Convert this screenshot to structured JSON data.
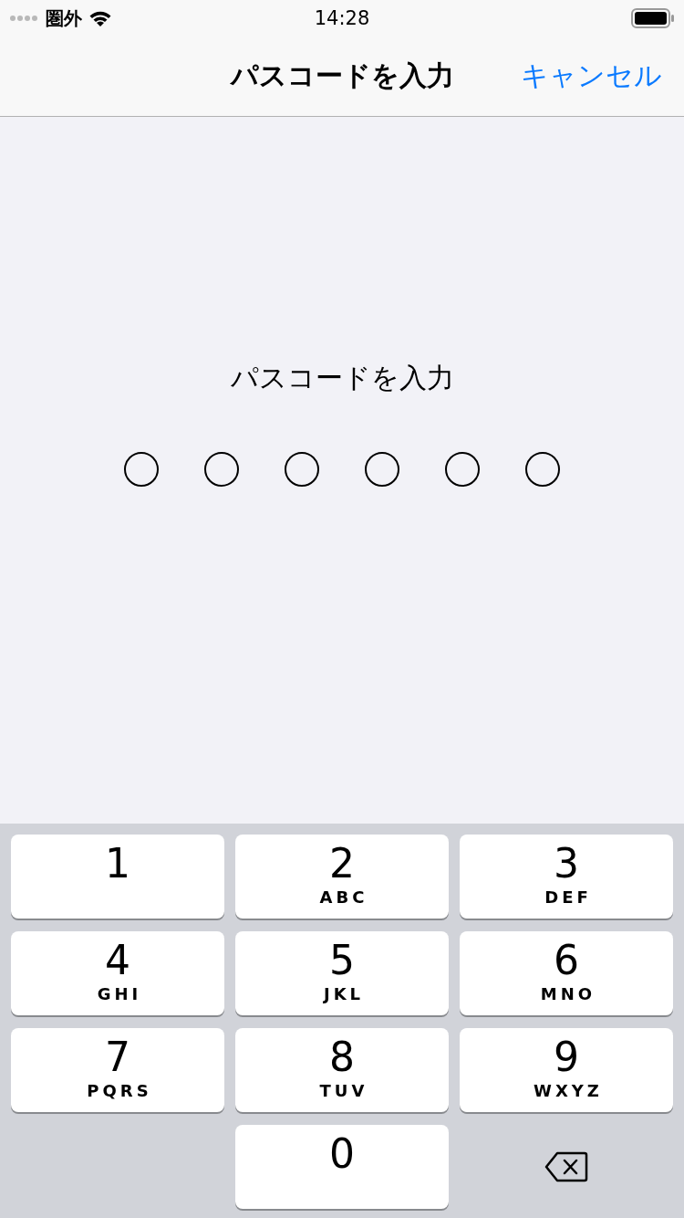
{
  "status_bar": {
    "carrier": "圏外",
    "time": "14:28"
  },
  "nav_bar": {
    "title": "パスコードを入力",
    "cancel": "キャンセル"
  },
  "prompt": "パスコードを入力",
  "passcode_dots": [
    {
      "filled": false
    },
    {
      "filled": false
    },
    {
      "filled": false
    },
    {
      "filled": false
    },
    {
      "filled": false
    },
    {
      "filled": false
    }
  ],
  "keypad": [
    {
      "kind": "digit",
      "digit": "1"
    },
    {
      "kind": "digit",
      "digit": "2",
      "letters": "ABC"
    },
    {
      "kind": "digit",
      "digit": "3",
      "letters": "DEF"
    },
    {
      "kind": "digit",
      "digit": "4",
      "letters": "GHI"
    },
    {
      "kind": "digit",
      "digit": "5",
      "letters": "JKL"
    },
    {
      "kind": "digit",
      "digit": "6",
      "letters": "MNO"
    },
    {
      "kind": "digit",
      "digit": "7",
      "letters": "PQRS"
    },
    {
      "kind": "digit",
      "digit": "8",
      "letters": "TUV"
    },
    {
      "kind": "digit",
      "digit": "9",
      "letters": "WXYZ"
    },
    {
      "kind": "blank"
    },
    {
      "kind": "digit",
      "digit": "0"
    },
    {
      "kind": "delete"
    }
  ]
}
